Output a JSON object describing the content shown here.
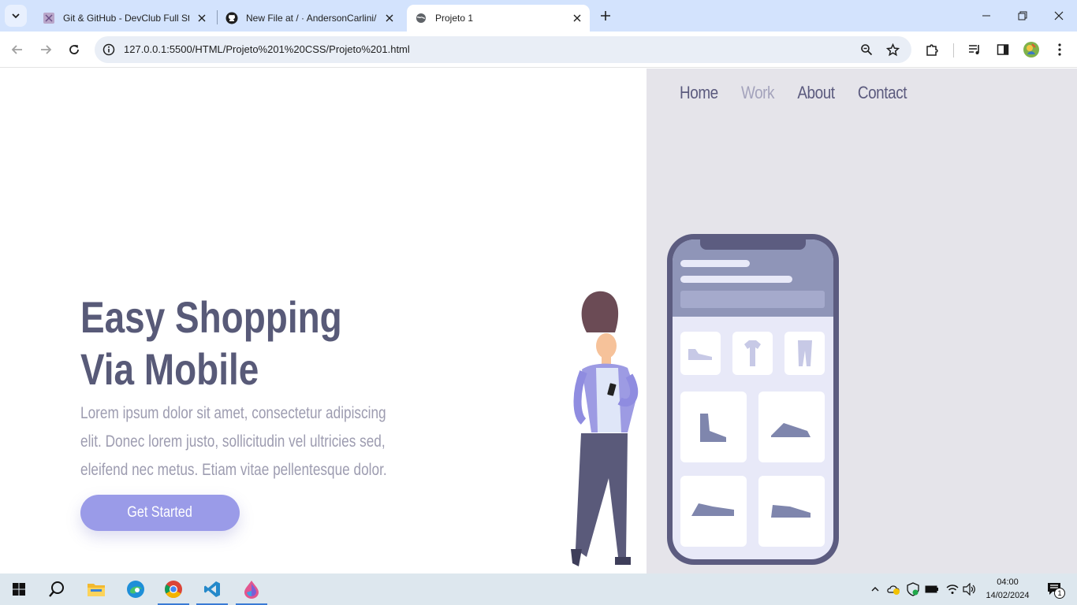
{
  "browser": {
    "tabs": [
      {
        "title": "Git & GitHub - DevClub Full Sta",
        "icon": "devclub-icon",
        "active": false
      },
      {
        "title": "New File at / · AndersonCarlini/",
        "icon": "github-icon",
        "active": false
      },
      {
        "title": "Projeto 1",
        "icon": "globe-icon",
        "active": true
      }
    ],
    "url": "127.0.0.1:5500/HTML/Projeto%201%20CSS/Projeto%201.html"
  },
  "page": {
    "nav": [
      {
        "label": "Home"
      },
      {
        "label": "Work"
      },
      {
        "label": "About"
      },
      {
        "label": "Contact"
      }
    ],
    "hero": {
      "title_line1": "Easy Shopping",
      "title_line2": "Via Mobile",
      "text": "Lorem ipsum dolor sit amet, consectetur adipiscing elit. Donec lorem justo, sollicitudin vel ultricies sed, eleifend nec metus. Etiam vitae pellentesque dolor.",
      "cta": "Get Started"
    },
    "colors": {
      "accent": "#9a9be8",
      "heading": "#585a78",
      "panel": "#e5e4ea"
    }
  },
  "taskbar": {
    "time": "04:00",
    "date": "14/02/2024",
    "notification_count": "1"
  }
}
